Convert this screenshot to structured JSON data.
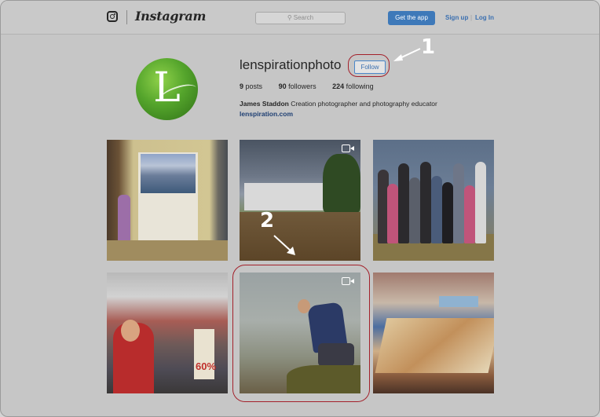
{
  "header": {
    "brand": "Instagram",
    "search_placeholder": "Search",
    "get_app_label": "Get the app",
    "signup_label": "Sign up",
    "separator": "|",
    "login_label": "Log In"
  },
  "profile": {
    "username": "lenspirationphoto",
    "follow_label": "Follow",
    "posts_count": "9",
    "posts_label": "posts",
    "followers_count": "90",
    "followers_label": "followers",
    "following_count": "224",
    "following_label": "following",
    "full_name": "James Staddon",
    "bio": "Creation photographer and photography educator",
    "website": "lenspiration.com",
    "avatar_letter": "L"
  },
  "grid": {
    "posts": [
      {
        "name": "post-1",
        "is_video": false
      },
      {
        "name": "post-2",
        "is_video": true
      },
      {
        "name": "post-3",
        "is_video": false
      },
      {
        "name": "post-4",
        "is_video": false,
        "sign_text": "60%"
      },
      {
        "name": "post-5",
        "is_video": true
      },
      {
        "name": "post-6",
        "is_video": false
      }
    ]
  },
  "annotations": {
    "callout_1": "1",
    "callout_2": "2",
    "highlight_color": "#a3202a"
  },
  "colors": {
    "accent": "#3e79b9",
    "link": "#3a6fb0"
  }
}
